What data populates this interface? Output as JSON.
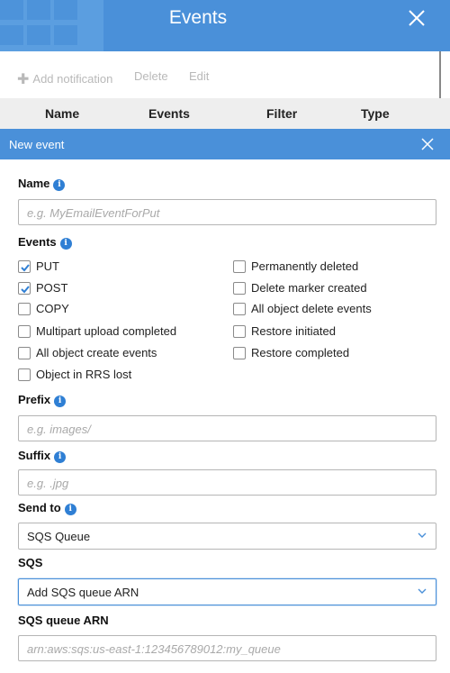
{
  "window": {
    "title": "Events"
  },
  "colors": {
    "header_bg": "#4a90d9",
    "accent": "#2f7fd4"
  },
  "toolbar": {
    "add_label": "Add notification",
    "delete_label": "Delete",
    "edit_label": "Edit"
  },
  "table": {
    "columns": [
      "Name",
      "Events",
      "Filter",
      "Type"
    ]
  },
  "panel": {
    "title": "New event"
  },
  "form": {
    "name": {
      "label": "Name",
      "placeholder": "e.g. MyEmailEventForPut"
    },
    "events": {
      "label": "Events",
      "items": [
        {
          "label": "PUT",
          "checked": true
        },
        {
          "label": "POST",
          "checked": true
        },
        {
          "label": "COPY",
          "checked": false
        },
        {
          "label": "Multipart upload completed",
          "checked": false
        },
        {
          "label": "All object create events",
          "checked": false
        },
        {
          "label": "Object in RRS lost",
          "checked": false
        },
        {
          "label": "Permanently deleted",
          "checked": false
        },
        {
          "label": "Delete marker created",
          "checked": false
        },
        {
          "label": "All object delete events",
          "checked": false
        },
        {
          "label": "Restore initiated",
          "checked": false
        },
        {
          "label": "Restore completed",
          "checked": false
        }
      ]
    },
    "prefix": {
      "label": "Prefix",
      "placeholder": "e.g. images/"
    },
    "suffix": {
      "label": "Suffix",
      "placeholder": "e.g. .jpg"
    },
    "send_to": {
      "label": "Send to",
      "value": "SQS Queue"
    },
    "sqs": {
      "label": "SQS",
      "value": "Add SQS queue ARN"
    },
    "sqs_arn": {
      "label": "SQS queue ARN",
      "placeholder": "arn:aws:sqs:us-east-1:123456789012:my_queue"
    }
  }
}
